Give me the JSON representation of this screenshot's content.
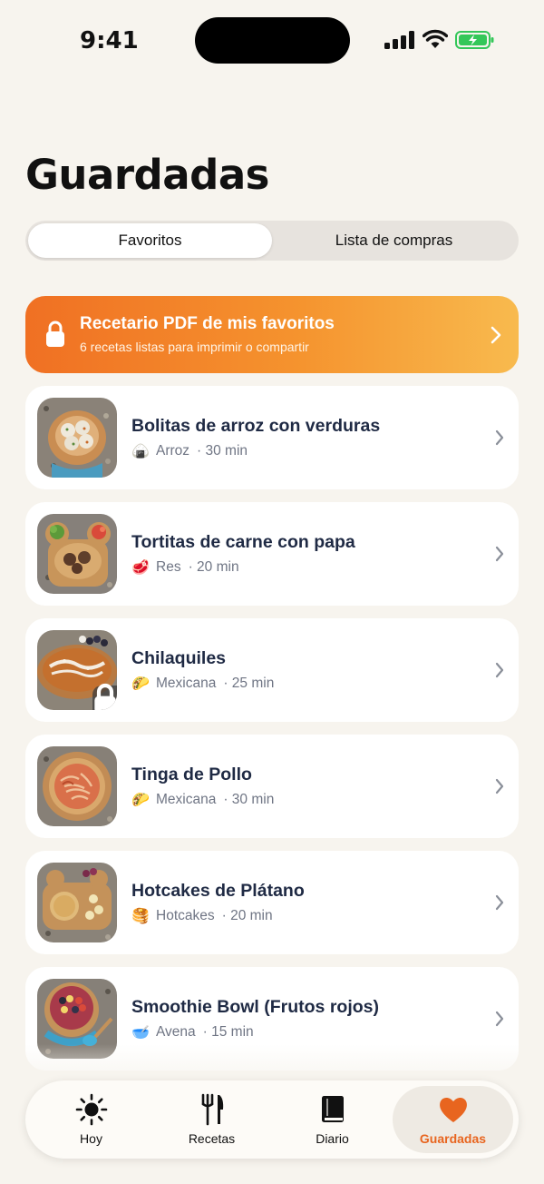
{
  "status": {
    "time": "9:41"
  },
  "header": {
    "title": "Guardadas"
  },
  "segments": [
    {
      "label": "Favoritos",
      "active": true
    },
    {
      "label": "Lista de compras",
      "active": false
    }
  ],
  "promo": {
    "title": "Recetario PDF de mis favoritos",
    "subtitle": "6 recetas listas para imprimir o compartir",
    "icon": "lock-icon"
  },
  "recipes": [
    {
      "name": "Bolitas de arroz con verduras",
      "emoji": "🍙",
      "category": "Arroz",
      "time": "· 30 min",
      "locked": false
    },
    {
      "name": "Tortitas de carne con papa",
      "emoji": "🥩",
      "category": "Res",
      "time": "· 20 min",
      "locked": false
    },
    {
      "name": "Chilaquiles",
      "emoji": "🌮",
      "category": "Mexicana",
      "time": "· 25 min",
      "locked": true
    },
    {
      "name": "Tinga de Pollo",
      "emoji": "🌮",
      "category": "Mexicana",
      "time": "· 30 min",
      "locked": false
    },
    {
      "name": "Hotcakes de Plátano",
      "emoji": "🥞",
      "category": "Hotcakes",
      "time": "· 20 min",
      "locked": false
    },
    {
      "name": "Smoothie Bowl (Frutos rojos)",
      "emoji": "🥣",
      "category": "Avena",
      "time": "· 15 min",
      "locked": false
    }
  ],
  "tabs": [
    {
      "label": "Hoy",
      "icon": "sun-icon",
      "active": false
    },
    {
      "label": "Recetas",
      "icon": "fork-knife-icon",
      "active": false
    },
    {
      "label": "Diario",
      "icon": "book-icon",
      "active": false
    },
    {
      "label": "Guardadas",
      "icon": "heart-icon",
      "active": true
    }
  ],
  "colors": {
    "accent": "#e8651f",
    "promo_start": "#f07023",
    "promo_end": "#f8ba4e",
    "background": "#f7f4ee"
  }
}
